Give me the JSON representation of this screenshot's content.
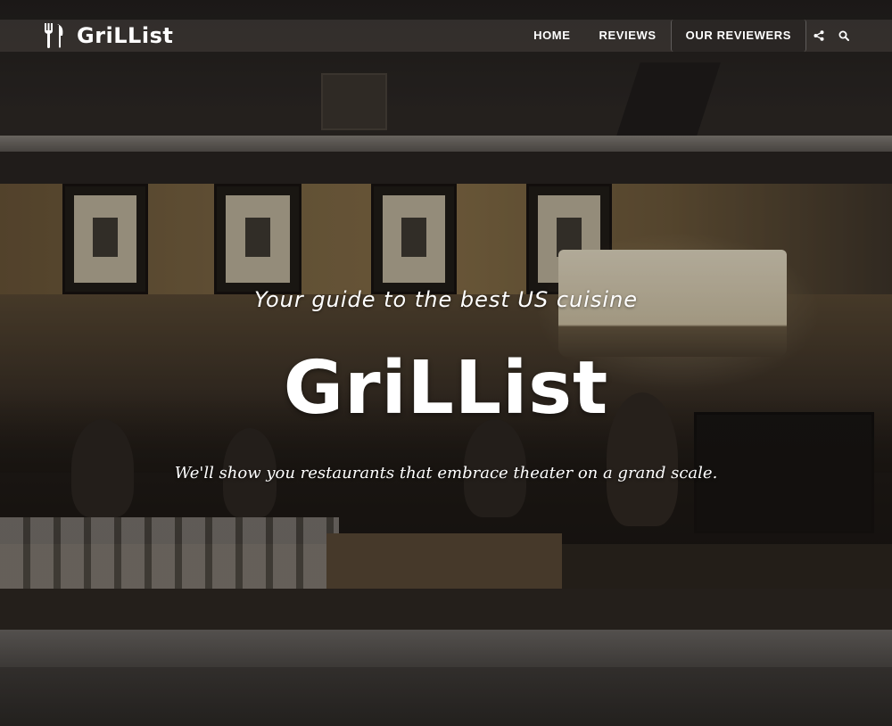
{
  "nav": {
    "brand": "GriLList",
    "logo_icon": "fork-knife-icon",
    "links": [
      {
        "label": "Home"
      },
      {
        "label": "Reviews"
      },
      {
        "label": "Our Reviewers"
      }
    ],
    "active_link": "Our Reviewers",
    "icons": [
      "share-icon",
      "search-icon"
    ]
  },
  "hero": {
    "tagline": "Your guide to the best US cuisine",
    "title": "GriLList",
    "subtitle": "We'll show you restaurants that embrace theater on a grand scale."
  },
  "colors": {
    "text": "#ffffff",
    "nav_bar": "#46403c"
  }
}
